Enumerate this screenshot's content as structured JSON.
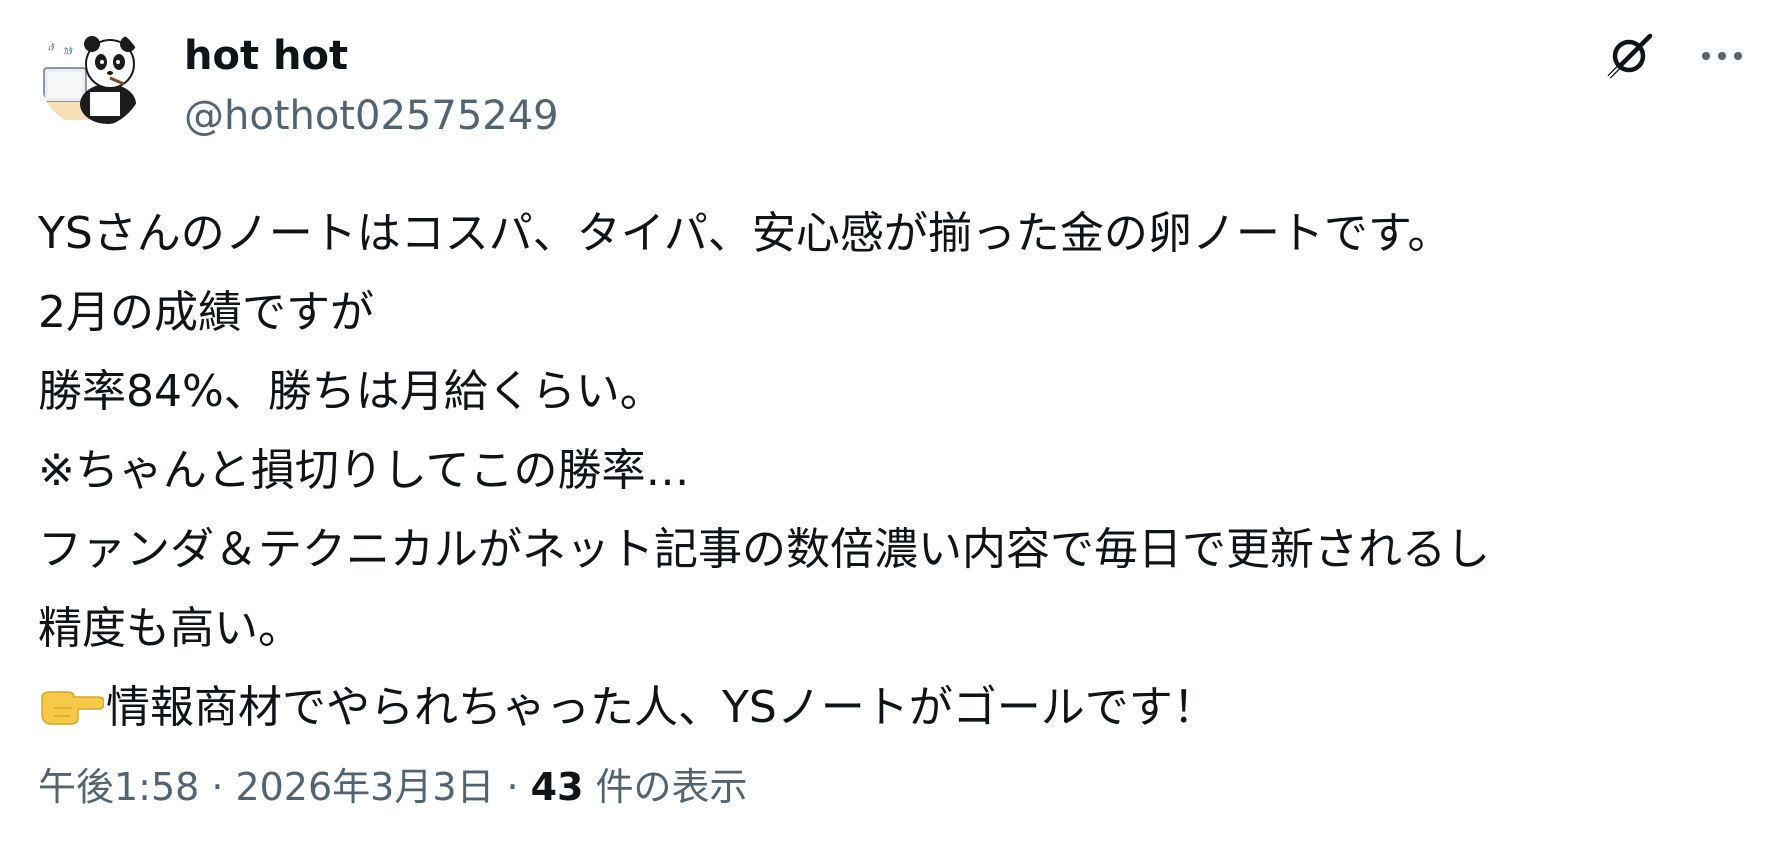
{
  "author": {
    "display_name": "hot hot",
    "handle": "@hothot02575249",
    "avatar_icon": "panda-avatar-icon"
  },
  "actions": {
    "grok_icon": "grok-icon",
    "more_icon": "more-horizontal-icon"
  },
  "tweet": {
    "lines": [
      "YSさんのノートはコスパ、タイパ、安心感が揃った金の卵ノートです。",
      "2月の成績ですが",
      "勝率84%、勝ちは月給くらい。",
      "※ちゃんと損切りしてこの勝率…",
      "ファンダ＆テクニカルがネット記事の数倍濃い内容で毎日で更新されるし",
      "精度も高い。"
    ],
    "last_line_emoji": "backhand-index-pointing-right-icon",
    "last_line_text": "情報商材でやられちゃった人、YSノートがゴールです！"
  },
  "meta": {
    "time": "午後1:58",
    "separator": "·",
    "date": "2026年3月3日",
    "views_count": "43",
    "views_label": "件の表示"
  },
  "colors": {
    "text_primary": "#0f1419",
    "text_secondary": "#536471",
    "emoji_skin": "#f7c948"
  }
}
